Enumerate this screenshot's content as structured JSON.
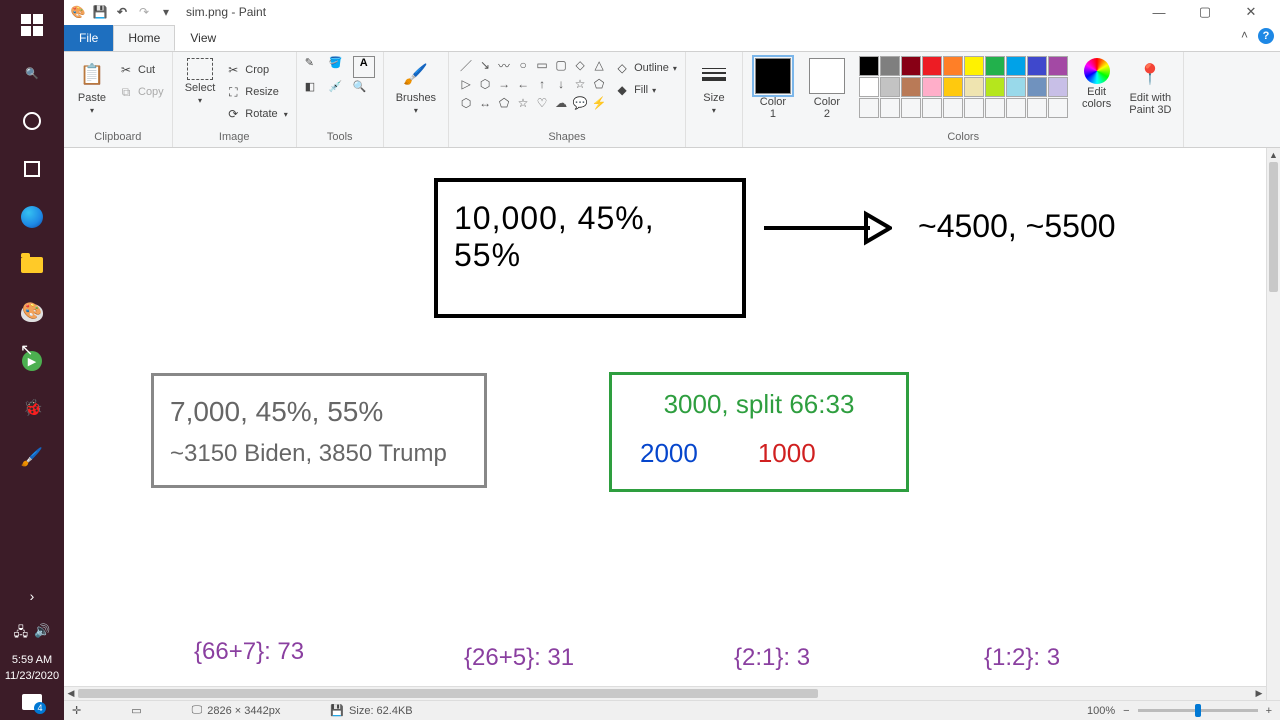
{
  "taskbar": {
    "clock_time": "5:59 AM",
    "clock_date": "11/23/2020",
    "notif_count": "4"
  },
  "title": {
    "filename": "sim.png",
    "app": "Paint"
  },
  "tabs": {
    "file": "File",
    "home": "Home",
    "view": "View"
  },
  "ribbon": {
    "clipboard": {
      "label": "Clipboard",
      "paste": "Paste",
      "cut": "Cut",
      "copy": "Copy"
    },
    "image": {
      "label": "Image",
      "select": "Select",
      "crop": "Crop",
      "resize": "Resize",
      "rotate": "Rotate"
    },
    "tools": {
      "label": "Tools"
    },
    "brushes": {
      "label": "Brushes",
      "btn": "Brushes"
    },
    "shapes": {
      "label": "Shapes",
      "outline": "Outline",
      "fill": "Fill"
    },
    "size": {
      "label": "Size",
      "btn": "Size"
    },
    "colors": {
      "label": "Colors",
      "c1": "Color\n1",
      "c2": "Color\n2",
      "edit": "Edit\ncolors",
      "p3d": "Edit with\nPaint 3D"
    }
  },
  "palette_row1": [
    "#000000",
    "#7f7f7f",
    "#880015",
    "#ed1c24",
    "#ff7f27",
    "#fff200",
    "#22b14c",
    "#00a2e8",
    "#3f48cc",
    "#a349a4"
  ],
  "palette_row2": [
    "#ffffff",
    "#c3c3c3",
    "#b97a57",
    "#ffaec9",
    "#ffc90e",
    "#efe4b0",
    "#b5e61d",
    "#99d9ea",
    "#7092be",
    "#c8bfe7"
  ],
  "canvas": {
    "box1": "10,000,   45%, 55%",
    "result1": "~4500,  ~5500",
    "box2_l1": "7,000, 45%, 55%",
    "box2_l2": "~3150 Biden, 3850 Trump",
    "box3_l1": "3000,  split 66:33",
    "box3_blue": "2000",
    "box3_red": "1000",
    "p1": "{66+7}: 73",
    "p2": "{26+5}: 31",
    "p3": "{2:1}: 3",
    "p4": "{1:2}: 3"
  },
  "status": {
    "dims": "2826 × 3442px",
    "size": "Size: 62.4KB",
    "zoom": "100%"
  }
}
